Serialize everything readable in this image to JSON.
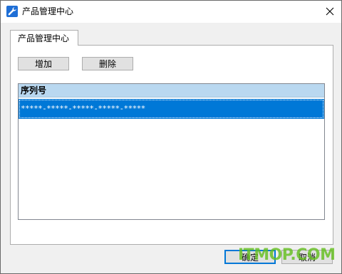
{
  "window": {
    "title": "产品管理中心",
    "app_icon": "wrench-icon",
    "close_icon": "close-icon"
  },
  "tabs": [
    {
      "label": "产品管理中心",
      "selected": true
    }
  ],
  "toolbar": {
    "add_label": "增加",
    "delete_label": "删除"
  },
  "list": {
    "column_header": "序列号",
    "rows": [
      {
        "serial": "*****-*****-*****-*****-*****",
        "selected": true
      }
    ]
  },
  "footer": {
    "ok_label": "确定",
    "cancel_label": "取消"
  },
  "watermark": "ITMOP.COM",
  "colors": {
    "selection": "#0078d7",
    "header_bg": "#b9d8f0",
    "watermark": "#64be1e"
  }
}
